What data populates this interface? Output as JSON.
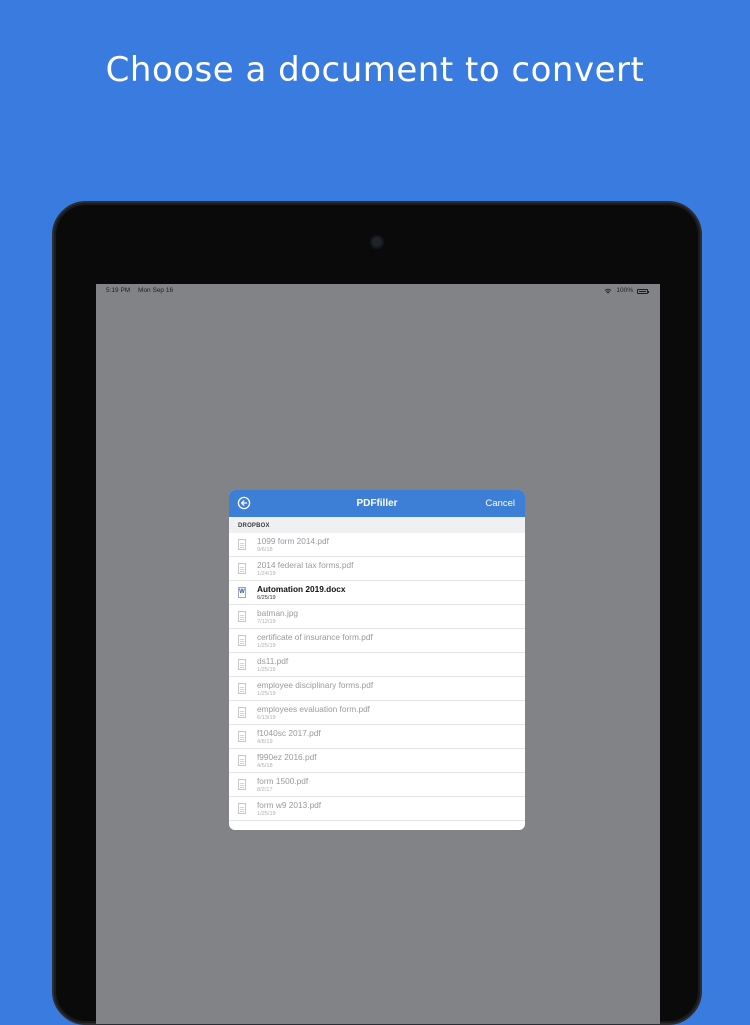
{
  "headline": "Choose a document to convert",
  "statusbar": {
    "time": "5:19 PM",
    "date": "Mon Sep 16",
    "battery": "100%",
    "battery_level": 1.0
  },
  "icons": {
    "back": "back-arrow-circle-icon",
    "wifi": "wifi-icon",
    "battery": "battery-icon",
    "pdf_file": "pdf-file-icon",
    "word_file": "word-file-icon",
    "image_file": "image-file-icon"
  },
  "colors": {
    "background": "#3a7be0",
    "header": "#3d7ed7",
    "screen_dim": "#828387"
  },
  "dialog": {
    "title": "PDFfiller",
    "cancel_label": "Cancel",
    "section": "DROPBOX",
    "files": [
      {
        "name": "1099 form 2014.pdf",
        "date": "9/6/18",
        "type": "pdf",
        "enabled": false
      },
      {
        "name": "2014 federal tax forms.pdf",
        "date": "1/24/19",
        "type": "pdf",
        "enabled": false
      },
      {
        "name": "Automation 2019.docx",
        "date": "6/25/19",
        "type": "docx",
        "enabled": true
      },
      {
        "name": "batman.jpg",
        "date": "7/12/19",
        "type": "jpg",
        "enabled": false
      },
      {
        "name": "certificate of insurance form.pdf",
        "date": "1/25/19",
        "type": "pdf",
        "enabled": false
      },
      {
        "name": "ds11.pdf",
        "date": "1/25/19",
        "type": "pdf",
        "enabled": false
      },
      {
        "name": "employee disciplinary forms.pdf",
        "date": "1/25/19",
        "type": "pdf",
        "enabled": false
      },
      {
        "name": "employees evaluation form.pdf",
        "date": "6/13/19",
        "type": "pdf",
        "enabled": false
      },
      {
        "name": "f1040sc 2017.pdf",
        "date": "4/8/19",
        "type": "pdf",
        "enabled": false
      },
      {
        "name": "f990ez 2016.pdf",
        "date": "4/5/18",
        "type": "pdf",
        "enabled": false
      },
      {
        "name": "form 1500.pdf",
        "date": "8/2/17",
        "type": "pdf",
        "enabled": false
      },
      {
        "name": "form w9 2013.pdf",
        "date": "1/25/19",
        "type": "pdf",
        "enabled": false
      }
    ]
  }
}
